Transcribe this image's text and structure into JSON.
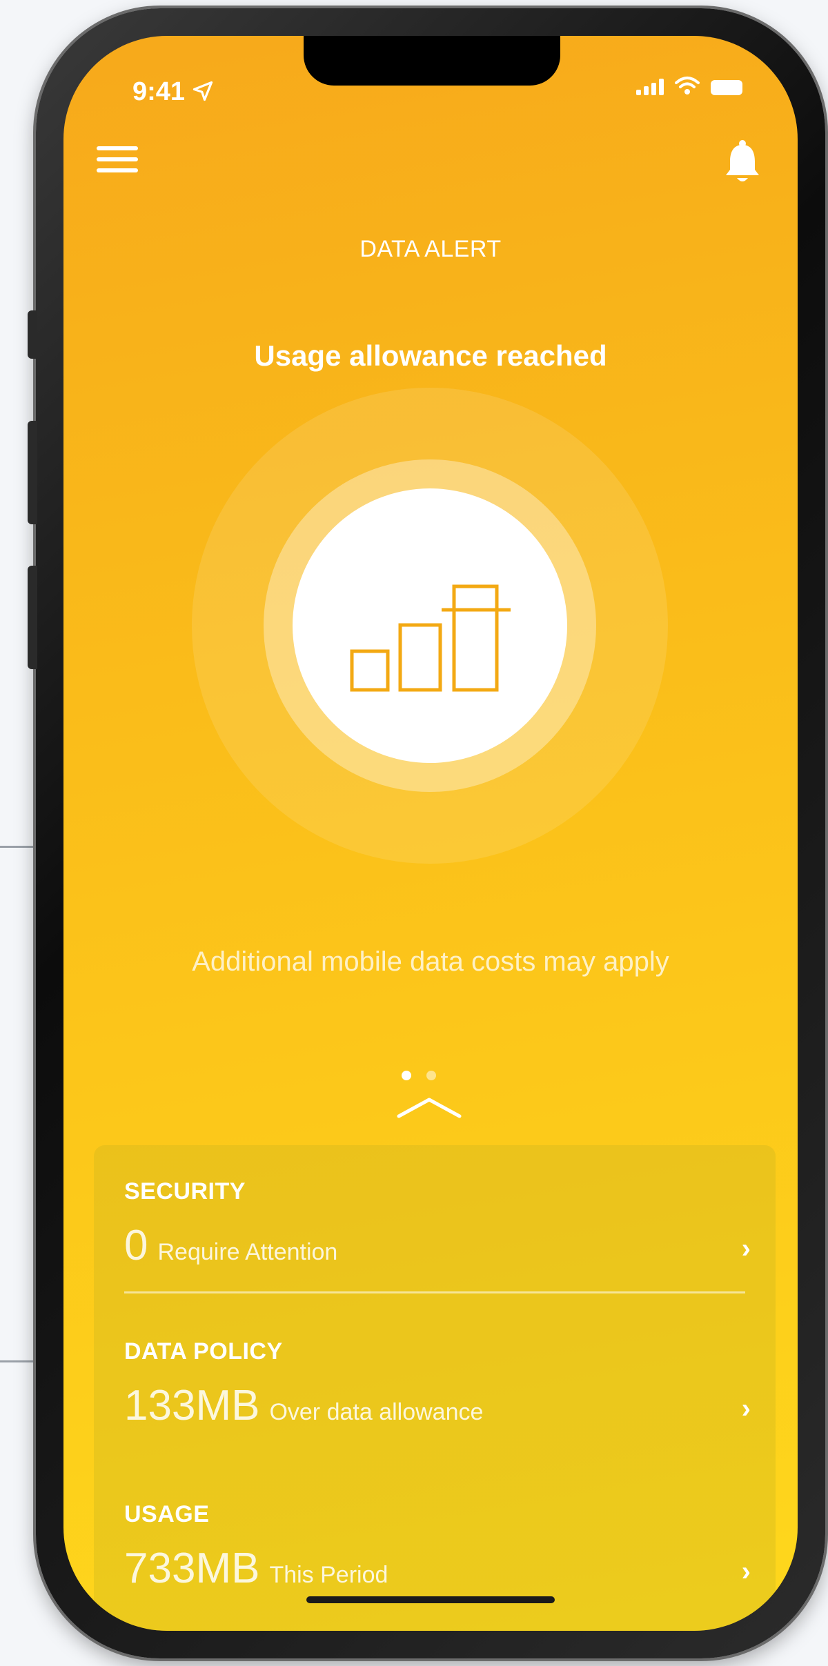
{
  "status_bar": {
    "time": "9:41",
    "location_icon": "location-arrow-icon",
    "signal_icon": "signal-icon",
    "wifi_icon": "wifi-icon",
    "battery_icon": "battery-icon"
  },
  "header": {
    "menu_icon": "hamburger-menu-icon",
    "notification_icon": "bell-icon",
    "title": "DATA ALERT"
  },
  "alert": {
    "heading": "Usage allowance reached",
    "icon": "bar-chart-icon",
    "footnote": "Additional mobile data costs may apply"
  },
  "pager": {
    "pages": 2,
    "active_index": 0,
    "expand_icon": "chevron-up-icon"
  },
  "panel": {
    "rows": [
      {
        "label": "SECURITY",
        "value": "0",
        "description": "Require Attention"
      },
      {
        "label": "DATA POLICY",
        "value": "133MB",
        "description": "Over data allowance"
      },
      {
        "label": "USAGE",
        "value": "733MB",
        "description": "This Period"
      }
    ],
    "row_chevron": "chevron-right-icon"
  },
  "colors": {
    "gradient_top": "#f7a91b",
    "gradient_bottom": "#fed81c",
    "icon_accent": "#f3a913",
    "text": "#ffffff"
  }
}
